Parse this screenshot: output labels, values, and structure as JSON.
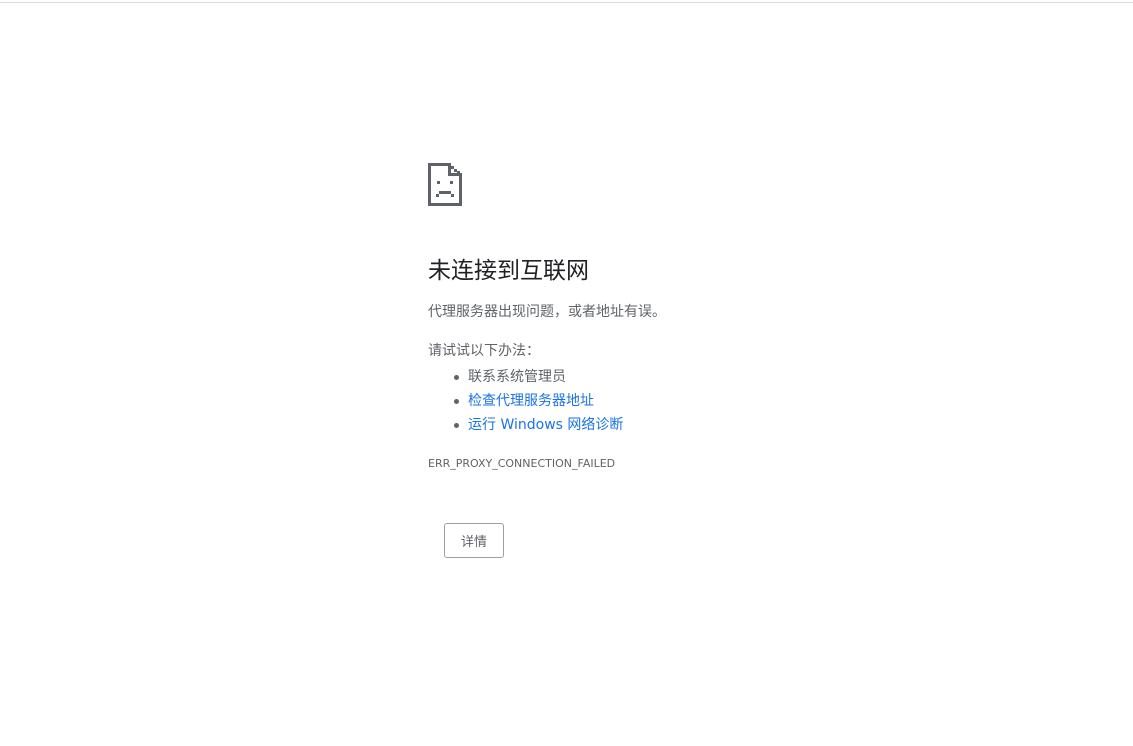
{
  "error_page": {
    "title": "未连接到互联网",
    "summary": "代理服务器出现问题，或者地址有误。",
    "suggestions_heading": "请试试以下办法：",
    "suggestions": [
      {
        "label": "联系系统管理员",
        "is_link": false
      },
      {
        "label": "检查代理服务器地址",
        "is_link": true
      },
      {
        "label": "运行 Windows 网络诊断",
        "is_link": true
      }
    ],
    "error_code": "ERR_PROXY_CONNECTION_FAILED",
    "details_button_label": "详情",
    "icon": "sad-page-icon"
  },
  "colors": {
    "link": "#1a73e8",
    "text": "#5f6368",
    "title": "#202124",
    "icon": "#5f6368"
  }
}
